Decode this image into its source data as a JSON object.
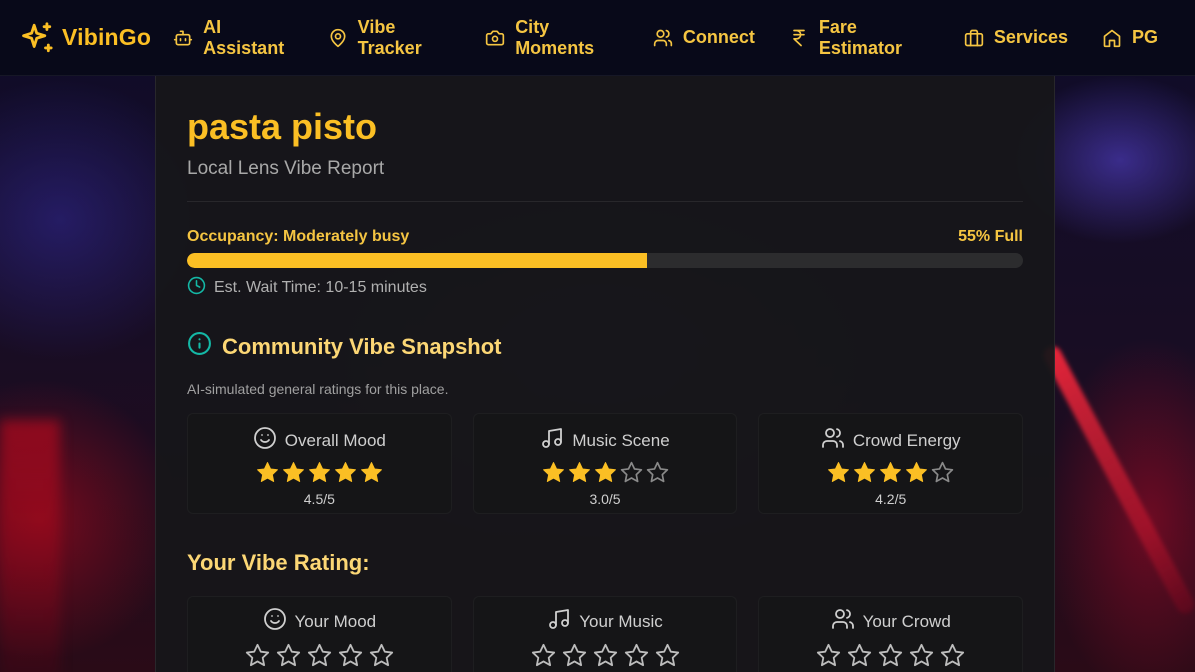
{
  "brand": {
    "name": "VibinGo",
    "icon": "sparkles-icon"
  },
  "nav": [
    {
      "label": "AI Assistant",
      "icon": "bot-icon"
    },
    {
      "label": "Vibe Tracker",
      "icon": "map-pin-icon"
    },
    {
      "label": "City Moments",
      "icon": "camera-icon"
    },
    {
      "label": "Connect",
      "icon": "users-icon"
    },
    {
      "label": "Fare Estimator",
      "icon": "rupee-icon"
    },
    {
      "label": "Services",
      "icon": "briefcase-icon"
    },
    {
      "label": "PG",
      "icon": "home-icon"
    }
  ],
  "place": {
    "name": "pasta pisto",
    "subtitle": "Local Lens Vibe Report"
  },
  "occupancy": {
    "label": "Occupancy: Moderately busy",
    "percent_label": "55% Full",
    "percent": 55,
    "wait_time": "Est. Wait Time: 10-15 minutes"
  },
  "community": {
    "title": "Community Vibe Snapshot",
    "subtitle": "AI-simulated general ratings for this place.",
    "ratings": [
      {
        "label": "Overall Mood",
        "icon": "smile-icon",
        "stars": 5,
        "score": "4.5/5"
      },
      {
        "label": "Music Scene",
        "icon": "music-icon",
        "stars": 3,
        "score": "3.0/5"
      },
      {
        "label": "Crowd Energy",
        "icon": "users-icon",
        "stars": 4,
        "score": "4.2/5"
      }
    ]
  },
  "your_rating": {
    "title": "Your Vibe Rating:",
    "items": [
      {
        "label": "Your Mood",
        "icon": "smile-icon",
        "stars": 0
      },
      {
        "label": "Your Music",
        "icon": "music-icon",
        "stars": 0
      },
      {
        "label": "Your Crowd",
        "icon": "users-icon",
        "stars": 0
      }
    ]
  },
  "colors": {
    "accent": "#fbbf24",
    "teal": "#14b8a6",
    "card_bg": "#16161a",
    "tile_bg": "#151517"
  }
}
